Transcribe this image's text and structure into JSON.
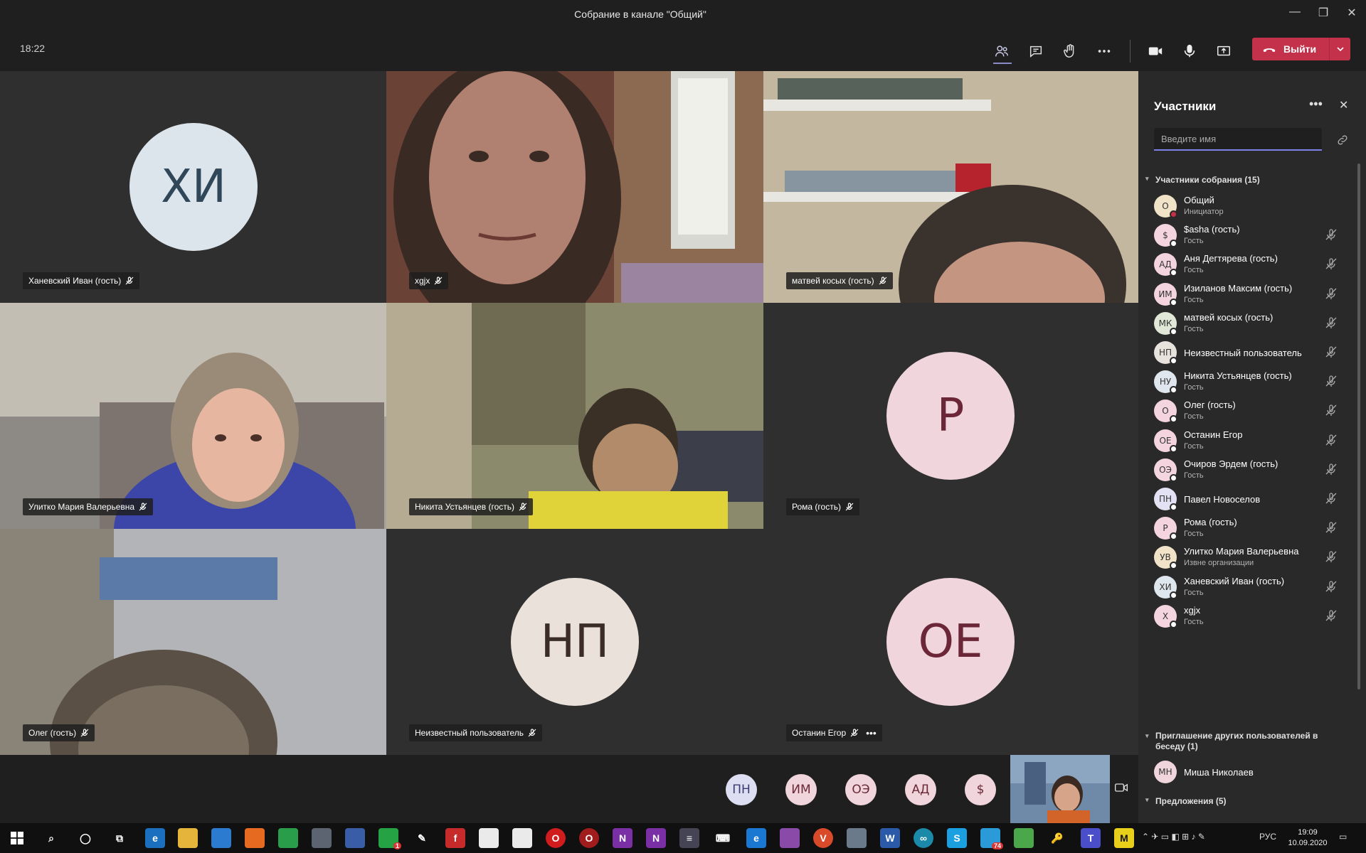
{
  "window": {
    "title": "Собрание в канале \"Общий\""
  },
  "toolbar": {
    "time": "18:22",
    "leave_label": "Выйти"
  },
  "tiles": [
    {
      "name": "Ханевский Иван (гость)",
      "initials": "ХИ"
    },
    {
      "name": "xgjx"
    },
    {
      "name": "матвей косых (гость)"
    },
    {
      "name": "Улитко Мария Валерьевна"
    },
    {
      "name": "Никита Устьянцев (гость)"
    },
    {
      "name": "Рома (гость)",
      "initials": "Р"
    },
    {
      "name": "Олег (гость)"
    },
    {
      "name": "Неизвестный пользователь",
      "initials": "НП"
    },
    {
      "name": "Останин Егор",
      "initials": "ОЕ"
    }
  ],
  "bottom_avatars": [
    "ПН",
    "ИМ",
    "ОЭ",
    "АД",
    "$"
  ],
  "panel": {
    "title": "Участники",
    "search_placeholder": "Введите имя",
    "section_meeting": "Участники собрания (15)",
    "section_invite": "Приглашение других пользователей в беседу (1)",
    "section_suggestions": "Предложения (5)",
    "participants": [
      {
        "initials": "О",
        "name": "Общий",
        "role": "Инициатор",
        "color": "#f0e3c8"
      },
      {
        "initials": "$",
        "name": "$asha (гость)",
        "role": "Гость",
        "color": "#f4d4de"
      },
      {
        "initials": "АД",
        "name": "Аня Дегтярева (гость)",
        "role": "Гость",
        "color": "#f4d4de"
      },
      {
        "initials": "ИМ",
        "name": "Изиланов Максим (гость)",
        "role": "Гость",
        "color": "#f4d4de"
      },
      {
        "initials": "МК",
        "name": "матвей косых (гость)",
        "role": "Гость",
        "color": "#e1e8d8"
      },
      {
        "initials": "НП",
        "name": "Неизвестный пользователь",
        "role": "",
        "color": "#e8e2dc"
      },
      {
        "initials": "НУ",
        "name": "Никита Устьянцев (гость)",
        "role": "Гость",
        "color": "#dfe6ee"
      },
      {
        "initials": "О",
        "name": "Олег (гость)",
        "role": "Гость",
        "color": "#f4d4de"
      },
      {
        "initials": "ОЕ",
        "name": "Останин Егор",
        "role": "Гость",
        "color": "#f4d4de"
      },
      {
        "initials": "ОЭ",
        "name": "Очиров Эрдем (гость)",
        "role": "Гость",
        "color": "#f4d4de"
      },
      {
        "initials": "ПН",
        "name": "Павел Новоселов",
        "role": "",
        "color": "#e2e2f4"
      },
      {
        "initials": "Р",
        "name": "Рома (гость)",
        "role": "Гость",
        "color": "#f4d4de"
      },
      {
        "initials": "УВ",
        "name": "Улитко Мария Валерьевна",
        "role": "Извне организации",
        "color": "#f0e3c8"
      },
      {
        "initials": "ХИ",
        "name": "Ханевский Иван (гость)",
        "role": "Гость",
        "color": "#dfe6ee"
      },
      {
        "initials": "Х",
        "name": "xgjx",
        "role": "Гость",
        "color": "#f4d4de"
      }
    ],
    "invited": [
      {
        "initials": "МН",
        "name": "Миша Николаев",
        "color": "#f4d4de"
      }
    ]
  },
  "taskbar": {
    "lang": "РУС",
    "time": "19:09",
    "date": "10.09.2020",
    "telegram_badge": "74",
    "whatsapp_badge": "1"
  },
  "colors": {
    "leave": "#c4314b",
    "accent": "#7b83eb"
  }
}
